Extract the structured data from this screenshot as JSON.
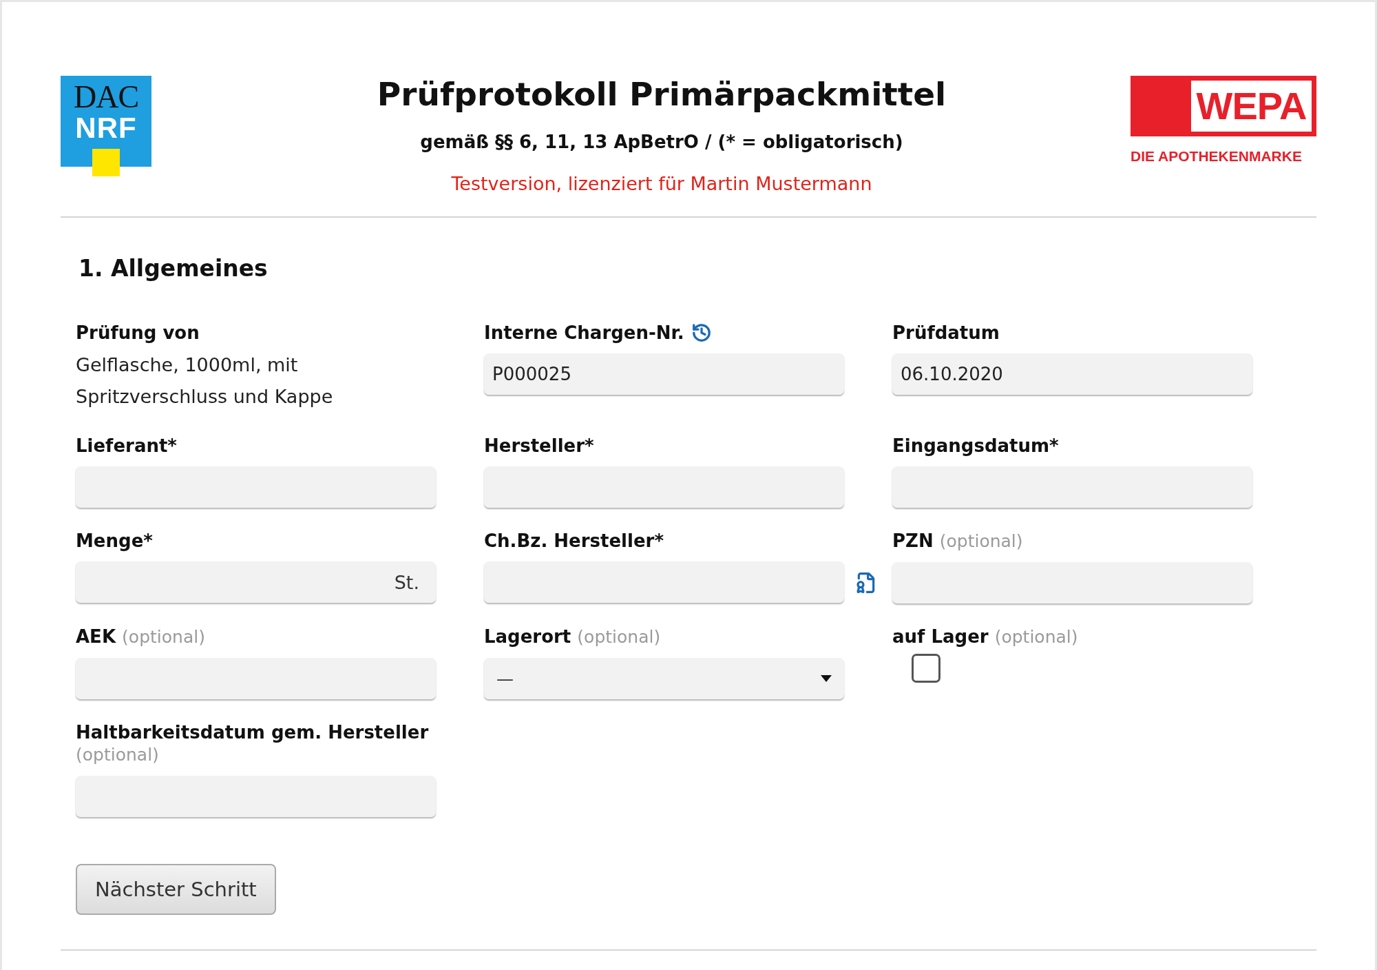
{
  "logos": {
    "left": {
      "top": "DAC",
      "bottom": "NRF"
    },
    "right": {
      "name": "WEPA",
      "tagline": "DIE APOTHEKENMARKE"
    }
  },
  "header": {
    "title": "Prüfprotokoll Primärpackmittel",
    "subtitle": "gemäß §§ 6, 11, 13 ApBetrO / (* = obligatorisch)",
    "notice": "Testversion, lizenziert für Martin Mustermann"
  },
  "section": {
    "title": "1. Allgemeines",
    "fields": [
      {
        "kind": "text",
        "label": "Prüfung von",
        "value": "Gelflasche, 1000ml, mit Spritzverschluss und Kappe"
      },
      {
        "kind": "input",
        "label": "Interne Chargen-Nr.",
        "value": "P000025"
      },
      {
        "kind": "input",
        "label": "Prüfdatum",
        "value": "06.10.2020"
      },
      {
        "kind": "input",
        "label": "Lieferant*"
      },
      {
        "kind": "input",
        "label": "Hersteller*"
      },
      {
        "kind": "input",
        "label": "Eingangsdatum*"
      },
      {
        "kind": "input",
        "label": "Menge*",
        "suffix": "St."
      },
      {
        "kind": "input",
        "label": "Ch.Bz. Hersteller*"
      },
      {
        "kind": "input",
        "label": "PZN",
        "note": "(optional)"
      },
      {
        "kind": "input",
        "label": "AEK",
        "note": "(optional)"
      },
      {
        "kind": "select",
        "label": "Lagerort",
        "note": "(optional)",
        "value": "—"
      },
      {
        "kind": "checkbox",
        "label": "auf Lager",
        "note": "(optional)",
        "checked": false
      },
      {
        "kind": "input",
        "label": "Haltbarkeitsdatum gem. Hersteller",
        "note": "(optional)"
      }
    ],
    "button": "Nächster Schritt"
  }
}
